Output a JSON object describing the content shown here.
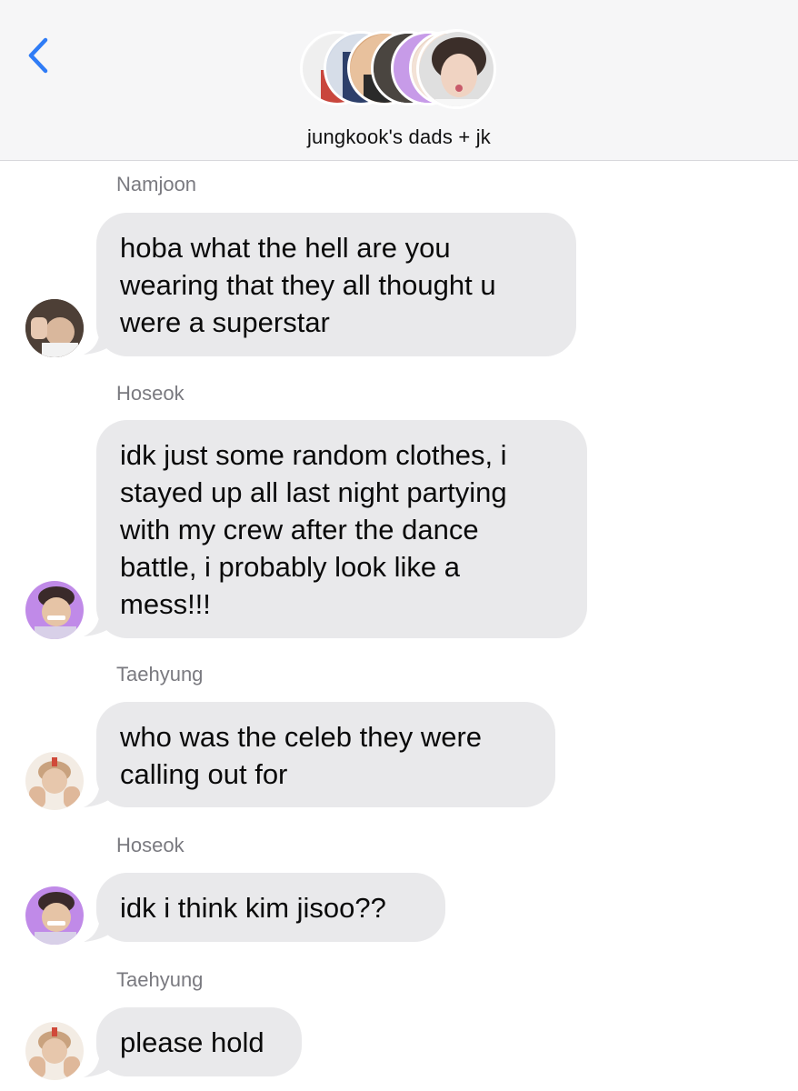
{
  "header": {
    "group_name": "jungkook's dads + jk",
    "back_icon": "chevron-left-icon",
    "accent_color": "#2f7cf6"
  },
  "messages": [
    {
      "sender": "Namjoon",
      "text": "hoba what the hell are you\nwearing that they all thought u\nwere a superstar"
    },
    {
      "sender": "Hoseok",
      "text": "idk just some random clothes, i\nstayed up all last night partying\nwith my crew after the dance\nbattle, i probably look like a\nmess!!!"
    },
    {
      "sender": "Taehyung",
      "text": "who was the celeb they were\ncalling out for"
    },
    {
      "sender": "Hoseok",
      "text": "idk i think kim jisoo??"
    },
    {
      "sender": "Taehyung",
      "text": "please hold"
    }
  ],
  "colors": {
    "bubble": "#e9e9eb",
    "header_bg": "#f6f6f7",
    "sender_text": "#7a7a80"
  }
}
